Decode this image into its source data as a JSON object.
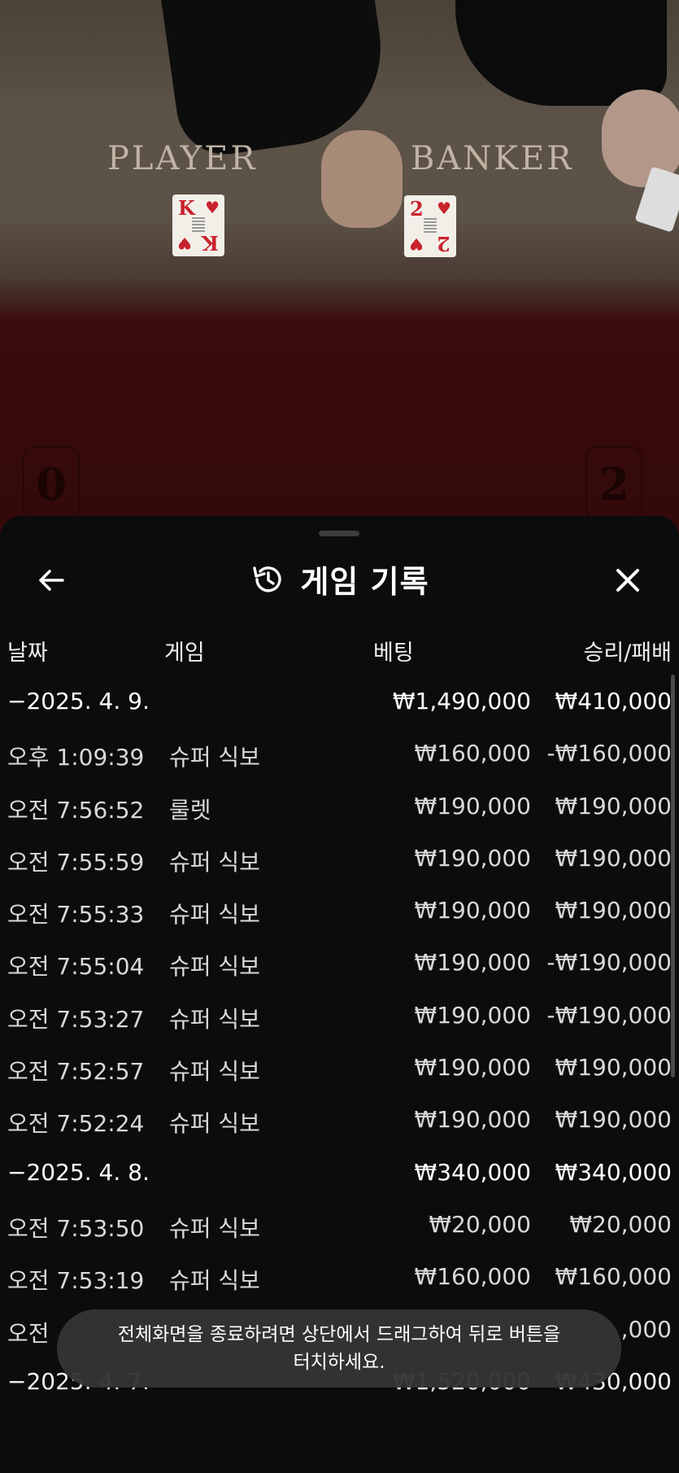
{
  "video": {
    "player_label": "PLAYER",
    "banker_label": "BANKER",
    "player_card": {
      "rank": "K",
      "suit": "♥"
    },
    "banker_card": {
      "rank": "2",
      "suit": "♥"
    },
    "player_score": "0",
    "banker_score": "2"
  },
  "sheet": {
    "title": "게임 기록",
    "title_icon": "history-icon",
    "back_icon": "arrow-left-icon",
    "close_icon": "close-icon",
    "columns": {
      "date": "날짜",
      "game": "게임",
      "bet": "베팅",
      "result": "승리/패배"
    },
    "rows": [
      {
        "type": "group",
        "date": "−2025. 4. 9.",
        "game": "",
        "bet": "₩1,490,000",
        "result": "₩410,000"
      },
      {
        "type": "item",
        "date": "오후 1:09:39",
        "game": "슈퍼 식보",
        "bet": "₩160,000",
        "result": "-₩160,000"
      },
      {
        "type": "item",
        "date": "오전 7:56:52",
        "game": "룰렛",
        "bet": "₩190,000",
        "result": "₩190,000"
      },
      {
        "type": "item",
        "date": "오전 7:55:59",
        "game": "슈퍼 식보",
        "bet": "₩190,000",
        "result": "₩190,000"
      },
      {
        "type": "item",
        "date": "오전 7:55:33",
        "game": "슈퍼 식보",
        "bet": "₩190,000",
        "result": "₩190,000"
      },
      {
        "type": "item",
        "date": "오전 7:55:04",
        "game": "슈퍼 식보",
        "bet": "₩190,000",
        "result": "-₩190,000"
      },
      {
        "type": "item",
        "date": "오전 7:53:27",
        "game": "슈퍼 식보",
        "bet": "₩190,000",
        "result": "-₩190,000"
      },
      {
        "type": "item",
        "date": "오전 7:52:57",
        "game": "슈퍼 식보",
        "bet": "₩190,000",
        "result": "₩190,000"
      },
      {
        "type": "item",
        "date": "오전 7:52:24",
        "game": "슈퍼 식보",
        "bet": "₩190,000",
        "result": "₩190,000"
      },
      {
        "type": "group",
        "date": "−2025. 4. 8.",
        "game": "",
        "bet": "₩340,000",
        "result": "₩340,000"
      },
      {
        "type": "item",
        "date": "오전 7:53:50",
        "game": "슈퍼 식보",
        "bet": "₩20,000",
        "result": "₩20,000"
      },
      {
        "type": "item",
        "date": "오전 7:53:19",
        "game": "슈퍼 식보",
        "bet": "₩160,000",
        "result": "₩160,000"
      },
      {
        "type": "item",
        "date": "오전",
        "game": "",
        "bet": "",
        "result": ",000"
      },
      {
        "type": "group",
        "date": "−2025. 4. 7.",
        "game": "",
        "bet": "₩1,520,000",
        "result": "₩430,000"
      }
    ]
  },
  "toast": {
    "line1": "전체화면을 종료하려면 상단에서 드래그하여 뒤로 버튼을",
    "line2": "터치하세요."
  }
}
